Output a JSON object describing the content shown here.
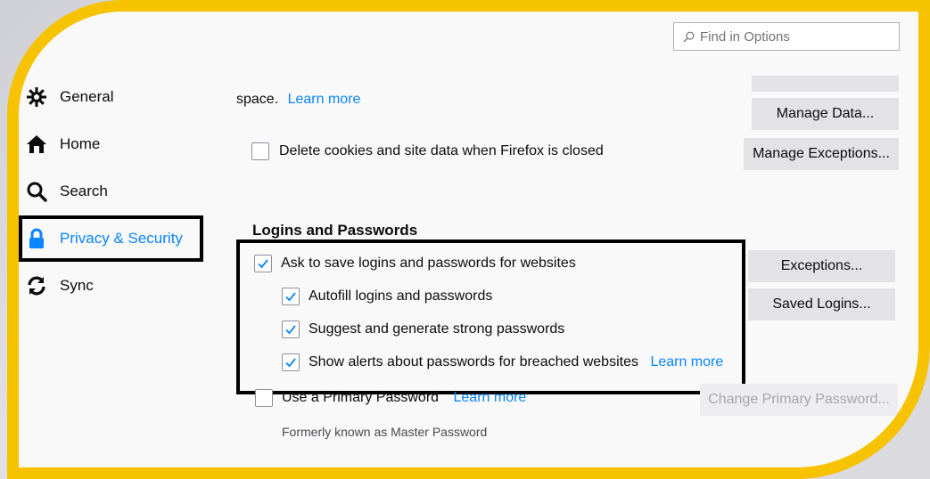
{
  "search": {
    "placeholder": "Find in Options"
  },
  "sidebar": {
    "items": [
      {
        "label": "General",
        "icon": "gear-icon"
      },
      {
        "label": "Home",
        "icon": "home-icon"
      },
      {
        "label": "Search",
        "icon": "search-icon"
      },
      {
        "label": "Privacy & Security",
        "icon": "lock-icon",
        "active": true
      },
      {
        "label": "Sync",
        "icon": "sync-icon"
      }
    ]
  },
  "cookies": {
    "space_text": "space.",
    "learn_more": "Learn more",
    "manage_data_button": "Manage Data...",
    "delete_on_close_label": "Delete cookies and site data when Firefox is closed",
    "delete_on_close_checked": false,
    "manage_exceptions_button": "Manage Exceptions..."
  },
  "logins": {
    "title": "Logins and Passwords",
    "ask_to_save_label": "Ask to save logins and passwords for websites",
    "ask_to_save_checked": true,
    "autofill_label": "Autofill logins and passwords",
    "autofill_checked": true,
    "suggest_label": "Suggest and generate strong passwords",
    "suggest_checked": true,
    "breach_alerts_label": "Show alerts about passwords for breached websites",
    "breach_alerts_checked": true,
    "breach_learn_more": "Learn more",
    "exceptions_button": "Exceptions...",
    "saved_logins_button": "Saved Logins...",
    "primary_password_label": "Use a Primary Password",
    "primary_password_checked": false,
    "primary_learn_more": "Learn more",
    "change_primary_button": "Change Primary Password...",
    "formerly_note": "Formerly known as Master Password"
  },
  "colors": {
    "frame": "#f7c200",
    "accent": "#0a84ff",
    "button": "#e3e3e6"
  }
}
